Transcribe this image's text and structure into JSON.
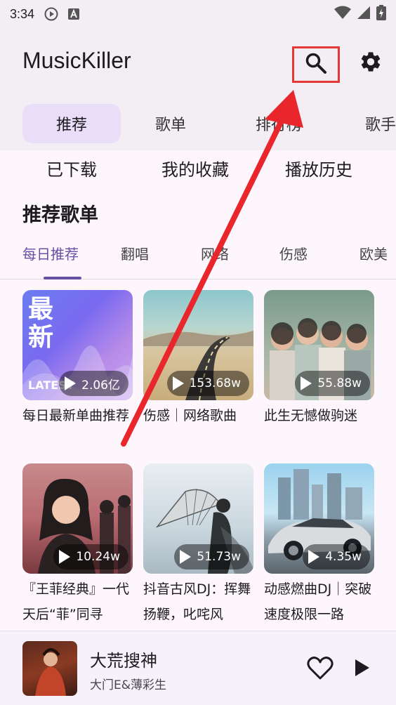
{
  "status": {
    "time": "3:34"
  },
  "app": {
    "title": "MusicKiller"
  },
  "tabs": [
    {
      "label": "推荐",
      "active": true
    },
    {
      "label": "歌单",
      "active": false
    },
    {
      "label": "排行榜",
      "active": false
    },
    {
      "label": "歌手",
      "active": false
    }
  ],
  "quick": [
    "已下载",
    "我的收藏",
    "播放历史"
  ],
  "section": {
    "title": "推荐歌单"
  },
  "categories": [
    {
      "label": "每日推荐",
      "active": true
    },
    {
      "label": "翻唱",
      "active": false
    },
    {
      "label": "网络",
      "active": false
    },
    {
      "label": "伤感",
      "active": false
    },
    {
      "label": "欧美",
      "active": false
    }
  ],
  "playlists": [
    {
      "title": "每日最新单曲推荐",
      "plays": "2.06亿",
      "cover_text": "最新",
      "cover_sub": "LATEST"
    },
    {
      "title": "伤感｜网络歌曲",
      "plays": "153.68w"
    },
    {
      "title": "此生无憾做驹迷",
      "plays": "55.88w"
    },
    {
      "title": "『王菲经典』一代天后“菲”同寻",
      "plays": "10.24w"
    },
    {
      "title": "抖音古风DJ：挥舞扬鞭，叱咤风",
      "plays": "51.73w"
    },
    {
      "title": "动感燃曲DJ｜突破速度极限一路",
      "plays": "4.35w"
    }
  ],
  "player": {
    "song": "大荒搜神",
    "artist": "大门E&薄彩生"
  },
  "colors": {
    "accent": "#6750a4",
    "highlight_box": "#e53935",
    "arrow": "#e8262c"
  }
}
